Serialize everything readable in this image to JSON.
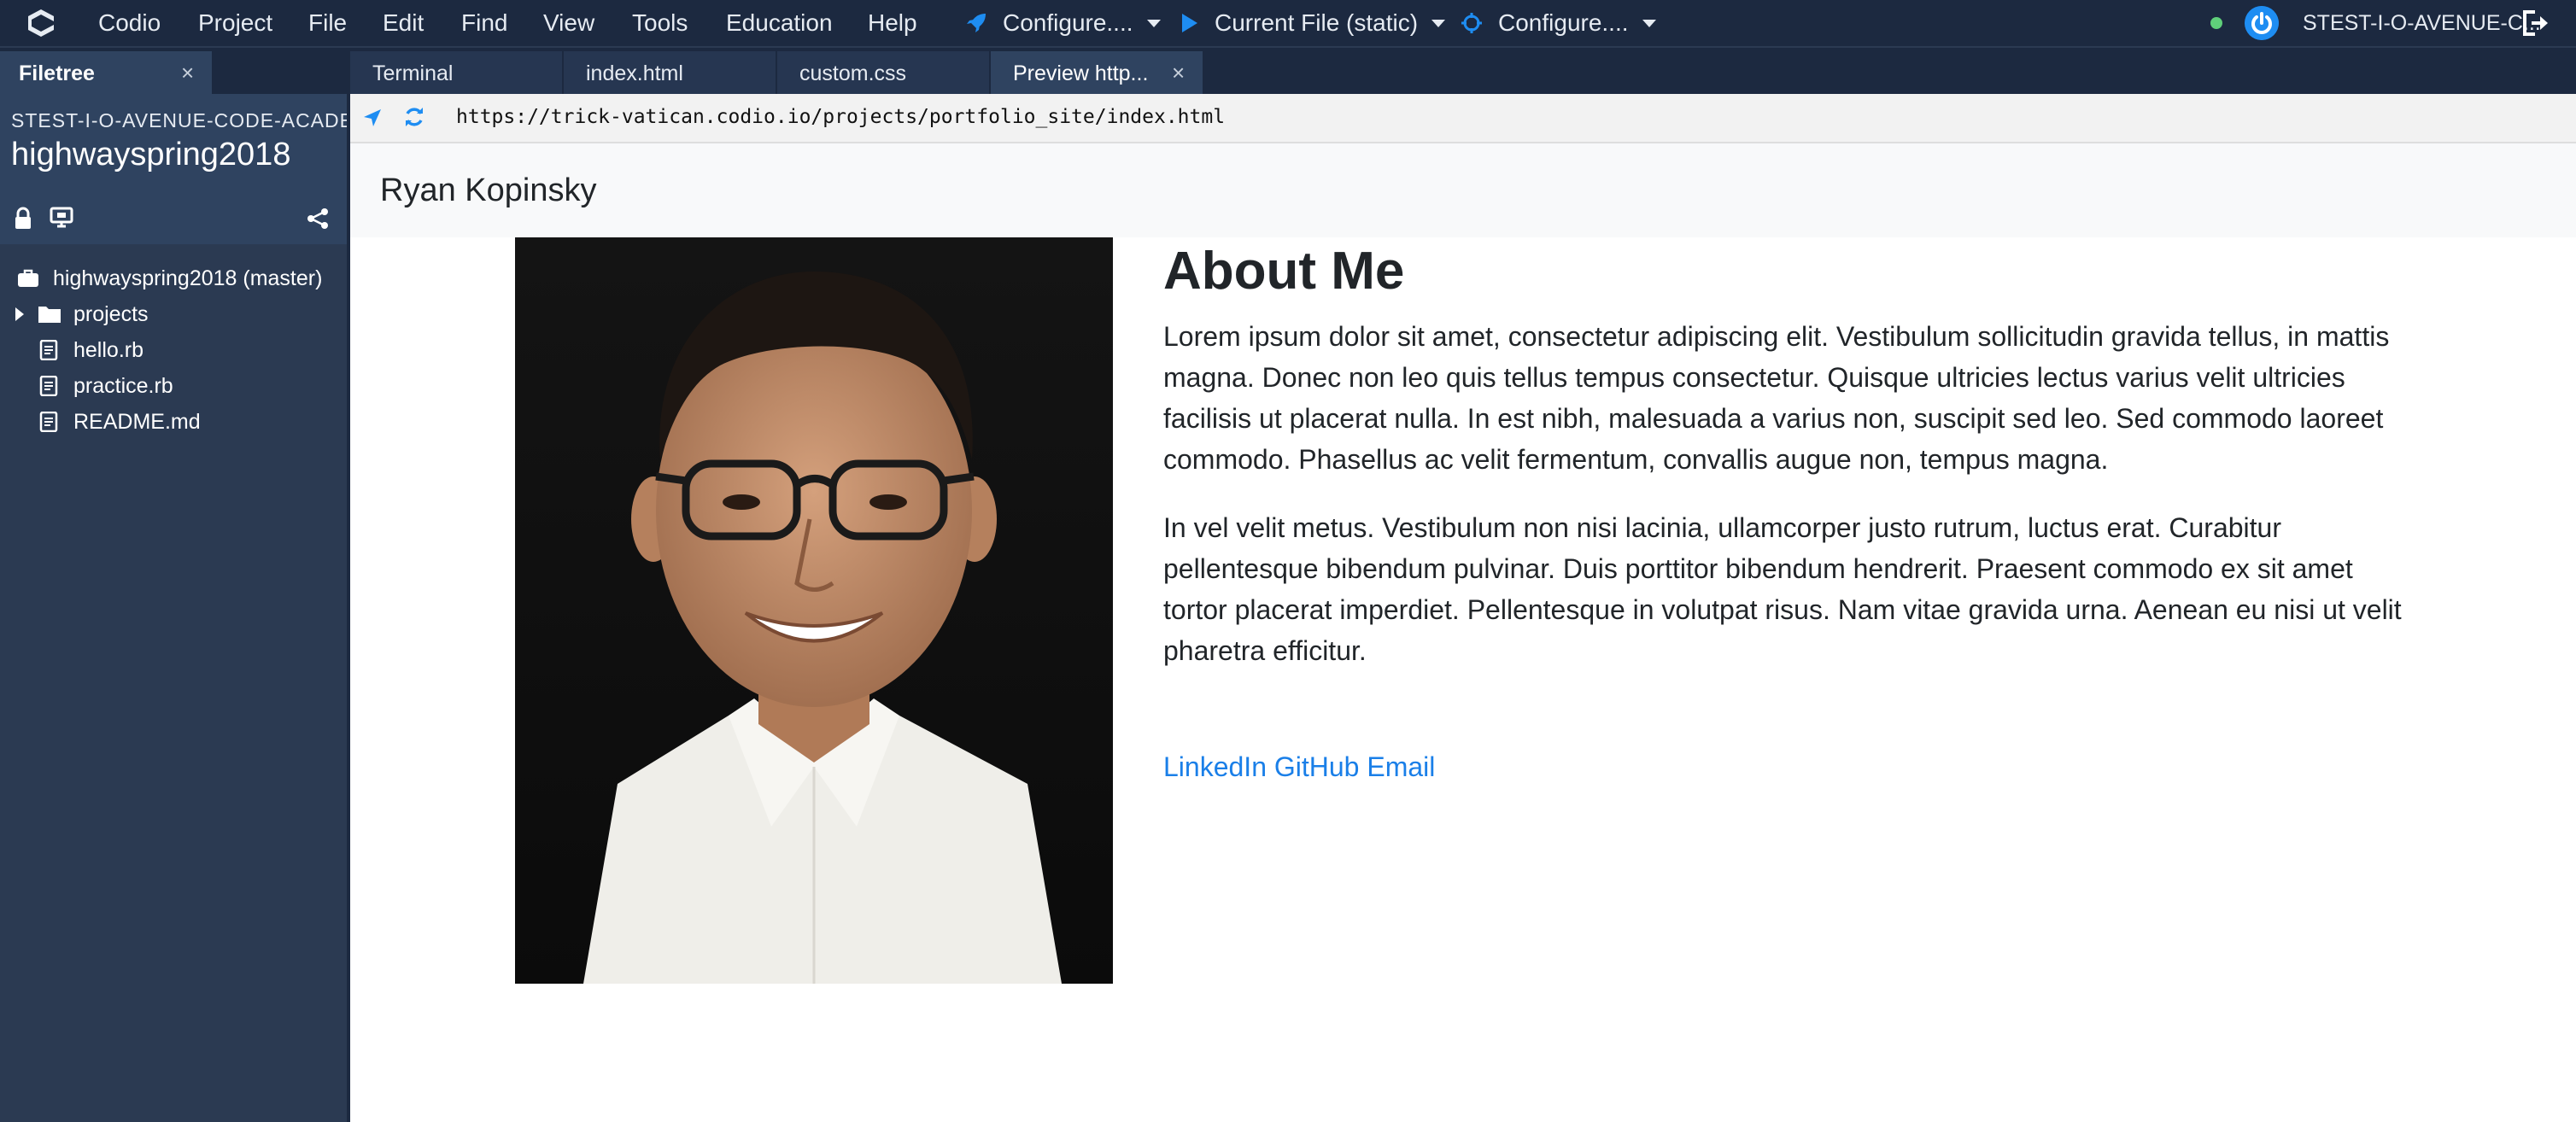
{
  "menubar": {
    "items": [
      "Codio",
      "Project",
      "File",
      "Edit",
      "Find",
      "View",
      "Tools",
      "Education",
      "Help"
    ],
    "configure1": "Configure....",
    "run_target": "Current File (static)",
    "configure2": "Configure....",
    "user": "STEST-I-O-AVENUE-C..."
  },
  "sidebar": {
    "tab_label": "Filetree",
    "tab_close": "×",
    "box_title": "STEST-I-O-AVENUE-CODE-ACADEMY",
    "project_name": "highwayspring2018",
    "tree": [
      {
        "label": "highwayspring2018 (master)",
        "icon": "briefcase-icon"
      },
      {
        "label": "projects",
        "icon": "folder-icon"
      },
      {
        "label": "hello.rb",
        "icon": "file-icon"
      },
      {
        "label": "practice.rb",
        "icon": "file-icon"
      },
      {
        "label": "README.md",
        "icon": "file-icon"
      }
    ]
  },
  "tabs": [
    {
      "label": "Terminal"
    },
    {
      "label": "index.html"
    },
    {
      "label": "custom.css"
    },
    {
      "label": "Preview http...",
      "close": "×"
    }
  ],
  "address": {
    "url": "https://trick-vatican.codio.io/projects/portfolio_site/index.html"
  },
  "preview": {
    "brand": "Ryan Kopinsky",
    "heading": "About Me",
    "paragraph1": "Lorem ipsum dolor sit amet, consectetur adipiscing elit. Vestibulum sollicitudin gravida tellus, in mattis magna. Donec non leo quis tellus tempus consectetur. Quisque ultricies lectus varius velit ultricies facilisis ut placerat nulla. In est nibh, malesuada a varius non, suscipit sed leo. Sed commodo laoreet commodo. Phasellus ac velit fermentum, convallis augue non, tempus magna.",
    "paragraph2": "In vel velit metus. Vestibulum non nisi lacinia, ullamcorper justo rutrum, luctus erat. Curabitur pellentesque bibendum pulvinar. Duis porttitor bibendum hendrerit. Praesent commodo ex sit amet tortor placerat imperdiet. Pellentesque in volutpat risus. Nam vitae gravida urna. Aenean eu nisi ut velit pharetra efficitur.",
    "links": [
      "LinkedIn",
      "GitHub",
      "Email"
    ]
  },
  "colors": {
    "menubar_bg": "#1c2940",
    "sidebar_bg": "#2b3a52",
    "accent": "#1e8df2",
    "link": "#1a7fe8"
  }
}
